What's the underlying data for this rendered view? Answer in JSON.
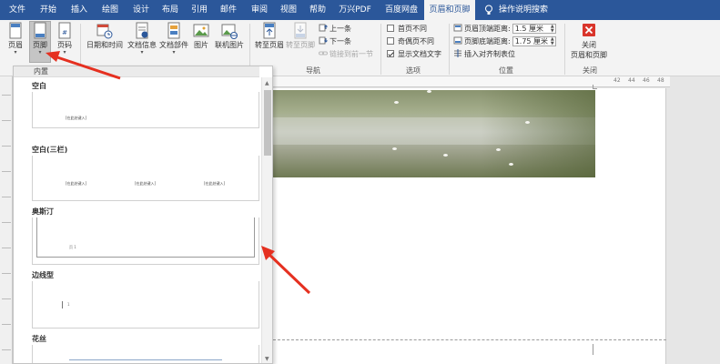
{
  "tabs": [
    {
      "label": "文件"
    },
    {
      "label": "开始"
    },
    {
      "label": "插入"
    },
    {
      "label": "绘图"
    },
    {
      "label": "设计"
    },
    {
      "label": "布局"
    },
    {
      "label": "引用"
    },
    {
      "label": "邮件"
    },
    {
      "label": "审阅"
    },
    {
      "label": "视图"
    },
    {
      "label": "帮助"
    },
    {
      "label": "万兴PDF"
    },
    {
      "label": "百度网盘"
    },
    {
      "label": "页眉和页脚"
    },
    {
      "label": "操作说明搜索"
    }
  ],
  "active_tab": "页眉和页脚",
  "ribbon": {
    "header_btn": "页眉",
    "footer_btn": "页脚",
    "pagenum_btn": "页码",
    "hf_group_label_fragment": "页",
    "datetime_btn": "日期和时间",
    "docinfo_btn": "文档信息",
    "docparts_btn": "文档部件",
    "picture_btn": "图片",
    "onlinepic_btn": "联机图片",
    "goto_header_btn": "转至页眉",
    "goto_footer_btn": "转至页脚",
    "prev_btn": "上一条",
    "next_btn": "下一条",
    "link_prev_btn": "链接到前一节",
    "nav_group_label": "导航",
    "opt_diff_first": "首页不同",
    "opt_odd_even": "奇偶页不同",
    "opt_show_text": "显示文档文字",
    "options_group_label": "选项",
    "header_top_label": "页眉顶端距离:",
    "header_top_value": "1.5 厘米",
    "footer_bottom_label": "页脚底端距离:",
    "footer_bottom_value": "1.75 厘米",
    "insert_align_tab": "插入对齐制表位",
    "position_group_label": "位置",
    "close_btn_line1": "关闭",
    "close_btn_line2": "页眉和页脚",
    "close_group_label": "关闭"
  },
  "checkbox_states": {
    "diff_first": false,
    "odd_even": false,
    "show_text": true
  },
  "dropdown": {
    "heading": "内置",
    "sections": [
      {
        "title": "空白",
        "placeholder": "[在此处键入]"
      },
      {
        "title": "空白(三栏)",
        "placeholders": [
          "[在此处键入]",
          "[在此处键入]",
          "[在此处键入]"
        ]
      },
      {
        "title": "奥斯汀",
        "sample": "页 1"
      },
      {
        "title": "边线型",
        "sample": "1"
      },
      {
        "title": "花丝"
      }
    ]
  },
  "ruler": {
    "h_labels": [
      "42",
      "44",
      "46",
      "48"
    ]
  },
  "colors": {
    "tab_bar": "#2b579a",
    "ribbon_bg": "#f3f3f3",
    "close_red": "#d9352b",
    "arrow_red": "#e53020"
  }
}
